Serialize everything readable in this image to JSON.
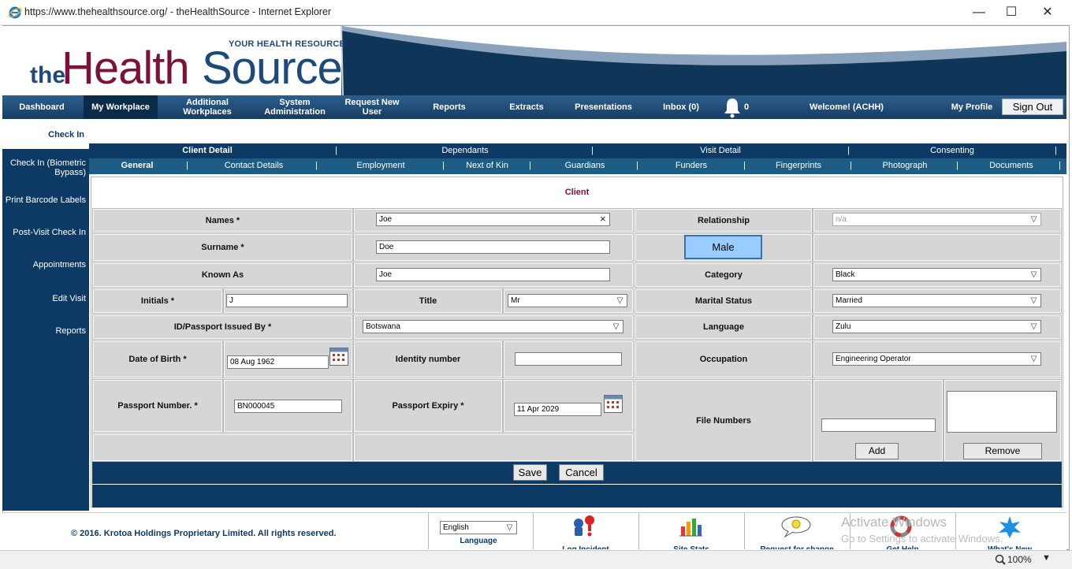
{
  "window": {
    "url": "https://www.thehealthsource.org/ - theHealthSource - Internet Explorer",
    "minimize": "—",
    "maximize": "☐",
    "close": "✕"
  },
  "logo": {
    "tagline": "YOUR HEALTH RESOURCE",
    "the": "the",
    "health": "Health",
    "source": "Source"
  },
  "nav": {
    "dashboard": "Dashboard",
    "my_workplace": "My Workplace",
    "additional_workplaces": "Additional Workplaces",
    "system_administration": "System Administration",
    "request_new_user": "Request New User",
    "reports": "Reports",
    "extracts": "Extracts",
    "presentations": "Presentations",
    "inbox": "Inbox (0)",
    "notifications": "0",
    "welcome": "Welcome! (ACHH)",
    "my_profile": "My Profile",
    "sign_out": "Sign Out"
  },
  "sidebar": {
    "check_in": "Check In",
    "check_in_biometric": "Check In (Biometric Bypass)",
    "print_barcode": "Print Barcode Labels",
    "post_visit": "Post-Visit Check In",
    "appointments": "Appointments",
    "edit_visit": "Edit Visit",
    "reports": "Reports"
  },
  "tabs1": {
    "client_detail": "Client Detail",
    "dependants": "Dependants",
    "visit_detail": "Visit Detail",
    "consenting": "Consenting",
    "sep": "|"
  },
  "tabs2": {
    "general": "General",
    "contact_details": "Contact Details",
    "employment": "Employment",
    "next_of_kin": "Next of Kin",
    "guardians": "Guardians",
    "funders": "Funders",
    "fingerprints": "Fingerprints",
    "photograph": "Photograph",
    "documents": "Documents",
    "sep": "|"
  },
  "form": {
    "section_title": "Client",
    "names_label": "Names *",
    "names_value": "Joe",
    "clear_icon": "×",
    "relationship_label": "Relationship",
    "relationship_value": "n/a",
    "surname_label": "Surname *",
    "surname_value": "Doe",
    "gender_button": "Male",
    "known_as_label": "Known As",
    "known_as_value": "Joe",
    "category_label": "Category",
    "category_value": "Black",
    "initials_label": "Initials *",
    "initials_value": "J",
    "title_label": "Title",
    "title_value": "Mr",
    "marital_label": "Marital Status",
    "marital_value": "Married",
    "id_issued_label": "ID/Passport Issued By *",
    "id_issued_value": "Botswana",
    "language_label": "Language",
    "language_value": "Zulu",
    "dob_label": "Date of Birth *",
    "dob_value": "08 Aug 1962",
    "identity_label": "Identity number",
    "identity_value": "",
    "occupation_label": "Occupation",
    "occupation_value": "Engineering Operator",
    "passport_label": "Passport Number. *",
    "passport_value": "BN000045",
    "expiry_label": "Passport Expiry *",
    "expiry_value": "11 Apr 2029",
    "file_numbers_label": "File Numbers",
    "file_number_value": "",
    "add_button": "Add",
    "remove_button": "Remove",
    "save_button": "Save",
    "cancel_button": "Cancel"
  },
  "footer": {
    "copyright": "© 2016. Krotoa Holdings Proprietary Limited. All rights reserved.",
    "language_value": "English",
    "language_label": "Language",
    "log_incident": "Log Incident",
    "site_stats": "Site Stats",
    "request_change": "Request for change",
    "get_help": "Get Help",
    "whats_new": "What's New"
  },
  "watermark": {
    "line1": "Activate Windows",
    "line2": "Go to Settings to activate Windows."
  },
  "status": {
    "zoom": "100%"
  },
  "colors": {
    "brand_navy": "#0d3a64",
    "brand_maroon": "#7a1336",
    "male_button": "#99ccff"
  }
}
